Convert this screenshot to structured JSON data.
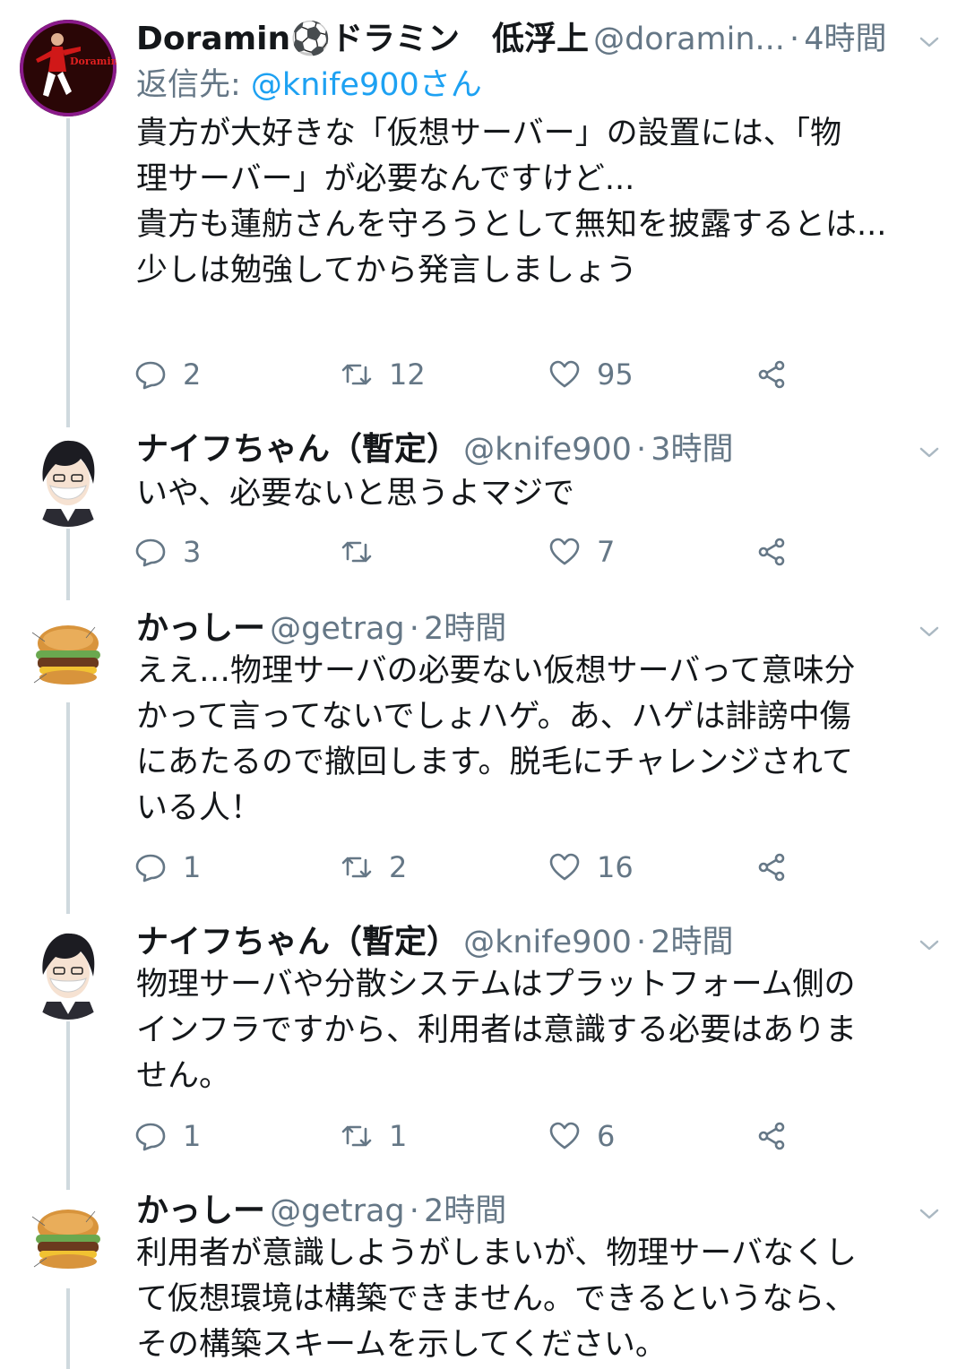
{
  "tweets": [
    {
      "name": "Doramin⚽ドラミン　低浮上",
      "handle": "@doramin...",
      "dot": "·",
      "time": "4時間",
      "reply_prefix": "返信先: ",
      "reply_to": "@knife900さん",
      "lines": [
        "貴方が大好きな「仮想サーバー」の設置には、「物",
        "理サーバー」が必要なんですけど...",
        "貴方も蓮舫さんを守ろうとして無知を披露するとは...",
        "少しは勉強してから発言しましょう"
      ],
      "replies": "2",
      "retweets": "12",
      "likes": "95",
      "avatar_text": "Doramin"
    },
    {
      "name": "ナイフちゃん（暫定）",
      "handle": "@knife900",
      "dot": "·",
      "time": "3時間",
      "lines": [
        "いや、必要ないと思うよマジで"
      ],
      "replies": "3",
      "retweets": "",
      "likes": "7"
    },
    {
      "name": "かっしー",
      "handle": "@getrag",
      "dot": "·",
      "time": "2時間",
      "lines": [
        "ええ…物理サーバの必要ない仮想サーバって意味分",
        "かって言ってないでしょハゲ。あ、ハゲは誹謗中傷",
        "にあたるので撤回します。脱毛にチャレンジされて",
        "いる人！"
      ],
      "replies": "1",
      "retweets": "2",
      "likes": "16"
    },
    {
      "name": "ナイフちゃん（暫定）",
      "handle": "@knife900",
      "dot": "·",
      "time": "2時間",
      "lines": [
        "物理サーバや分散システムはプラットフォーム側の",
        "インフラですから、利用者は意識する必要はありま",
        "せん。"
      ],
      "replies": "1",
      "retweets": "1",
      "likes": "6"
    },
    {
      "name": "かっしー",
      "handle": "@getrag",
      "dot": "·",
      "time": "2時間",
      "lines": [
        "利用者が意識しようがしまいが、物理サーバなくし",
        "て仮想環境は構築できません。できるというなら、",
        "その構築スキームを示してください。"
      ]
    }
  ]
}
